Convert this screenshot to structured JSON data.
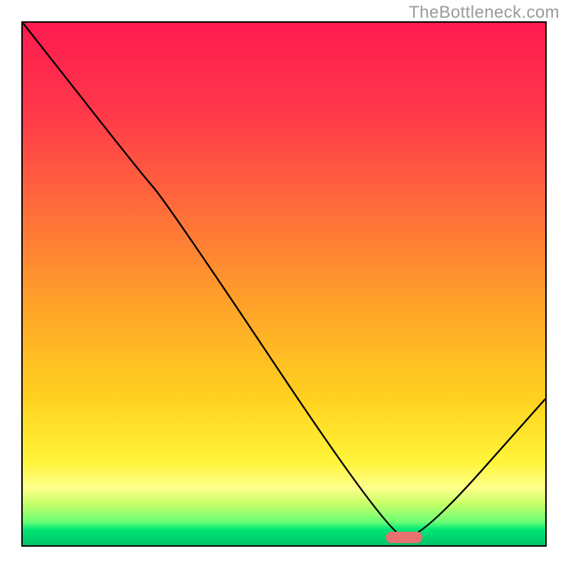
{
  "watermark": "TheBottleneck.com",
  "chart_data": {
    "type": "line",
    "title": "",
    "xlabel": "",
    "ylabel": "",
    "xlim": [
      0,
      100
    ],
    "ylim": [
      0,
      100
    ],
    "curve": [
      {
        "x": 0,
        "y": 100
      },
      {
        "x": 22,
        "y": 72
      },
      {
        "x": 28,
        "y": 65
      },
      {
        "x": 70,
        "y": 2
      },
      {
        "x": 76,
        "y": 1
      },
      {
        "x": 100,
        "y": 28
      }
    ],
    "marker": {
      "x": 73,
      "y": 1.5,
      "width": 7,
      "height": 2.2,
      "color": "#e97070"
    },
    "gradient_stops": [
      {
        "pos": 0,
        "color": "#ff1a4f"
      },
      {
        "pos": 0.18,
        "color": "#ff3a4a"
      },
      {
        "pos": 0.35,
        "color": "#ff6b3b"
      },
      {
        "pos": 0.55,
        "color": "#ffa528"
      },
      {
        "pos": 0.72,
        "color": "#ffd21f"
      },
      {
        "pos": 0.84,
        "color": "#fff43a"
      },
      {
        "pos": 0.89,
        "color": "#ffff8c"
      },
      {
        "pos": 0.92,
        "color": "#c8ff68"
      },
      {
        "pos": 0.955,
        "color": "#6cff76"
      },
      {
        "pos": 0.97,
        "color": "#00e676"
      },
      {
        "pos": 1.0,
        "color": "#00c26a"
      }
    ],
    "grid": false,
    "legend": false
  }
}
